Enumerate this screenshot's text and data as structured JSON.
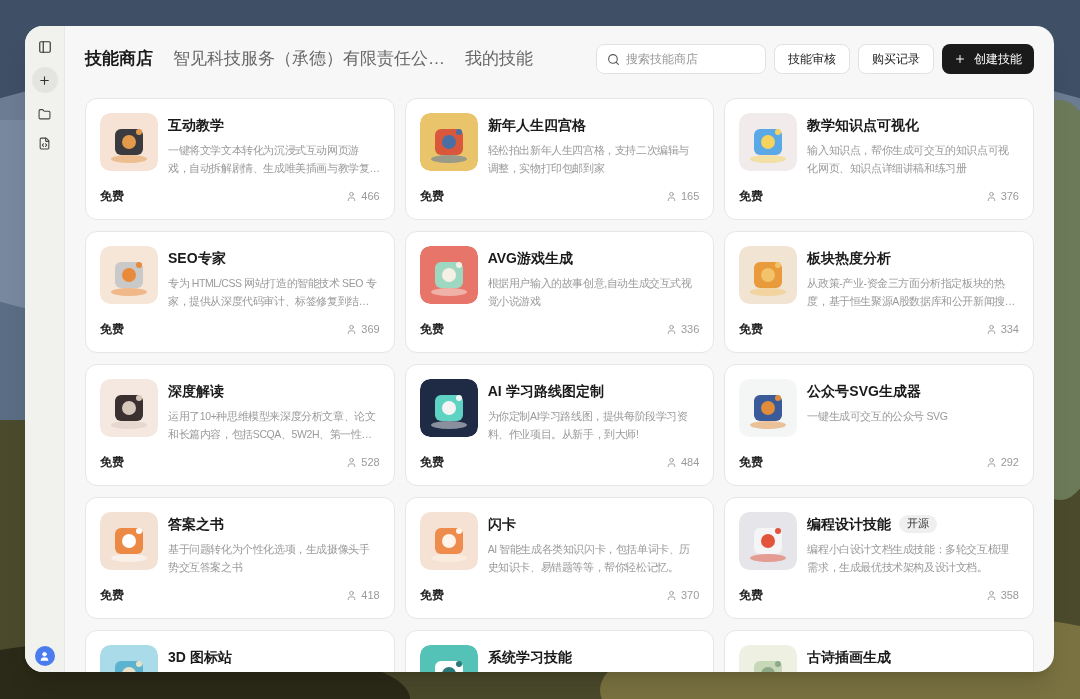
{
  "tabs": [
    {
      "label": "技能商店",
      "selected": true
    },
    {
      "label": "智见科技服务（承德）有限责任公…",
      "selected": false
    },
    {
      "label": "我的技能",
      "selected": false
    }
  ],
  "search": {
    "placeholder": "搜索技能商店"
  },
  "buttons": [
    {
      "label": "技能审核",
      "kind": "outline"
    },
    {
      "label": "购买记录",
      "kind": "outline"
    },
    {
      "label": "创建技能",
      "kind": "primary"
    }
  ],
  "skills": [
    {
      "title": "互动教学",
      "description": "一键将文学文本转化为沉浸式互动网页游戏，自动拆解剧情、生成唯美插画与教学复…",
      "price": "免费",
      "users": "466"
    },
    {
      "title": "新年人生四宫格",
      "description": "轻松拍出新年人生四宫格，支持二次编辑与调整，实物打印包邮到家",
      "price": "免费",
      "users": "165"
    },
    {
      "title": "教学知识点可视化",
      "description": "输入知识点，帮你生成可交互的知识点可视化网页、知识点详细讲稿和练习册",
      "price": "免费",
      "users": "376"
    },
    {
      "title": "SEO专家",
      "description": "专为 HTML/CSS 网站打造的智能技术 SEO 专家，提供从深度代码审计、标签修复到结…",
      "price": "免费",
      "users": "369"
    },
    {
      "title": "AVG游戏生成",
      "description": "根据用户输入的故事创意,自动生成交互式视觉小说游戏",
      "price": "免费",
      "users": "336"
    },
    {
      "title": "板块热度分析",
      "description": "从政策-产业-资金三方面分析指定板块的热度，基于恒生聚源A股数据库和公开新闻搜…",
      "price": "免费",
      "users": "334"
    },
    {
      "title": "深度解读",
      "description": "运用了10+种思维模型来深度分析文章、论文和长篇内容，包括SCQA、5W2H、第一性…",
      "price": "免费",
      "users": "528"
    },
    {
      "title": "AI 学习路线图定制",
      "description": "为你定制AI学习路线图，提供每阶段学习资料、作业项目。从新手，到大师!",
      "price": "免费",
      "users": "484"
    },
    {
      "title": "公众号SVG生成器",
      "description": "一键生成可交互的公众号 SVG",
      "price": "免费",
      "users": "292"
    },
    {
      "title": "答案之书",
      "description": "基于问题转化为个性化选项，生成摄像头手势交互答案之书",
      "price": "免费",
      "users": "418"
    },
    {
      "title": "闪卡",
      "description": "AI 智能生成各类知识闪卡，包括单词卡、历史知识卡、易错题等等，帮你轻松记忆。",
      "price": "免费",
      "users": "370"
    },
    {
      "title": "编程设计技能",
      "badge": "开源",
      "description": "编程小白设计文档生成技能：多轮交互梳理需求，生成最优技术架构及设计文档。",
      "price": "免费",
      "users": "358"
    },
    {
      "title": "3D 图标站"
    },
    {
      "title": "系统学习技能"
    },
    {
      "title": "古诗插画生成"
    }
  ]
}
